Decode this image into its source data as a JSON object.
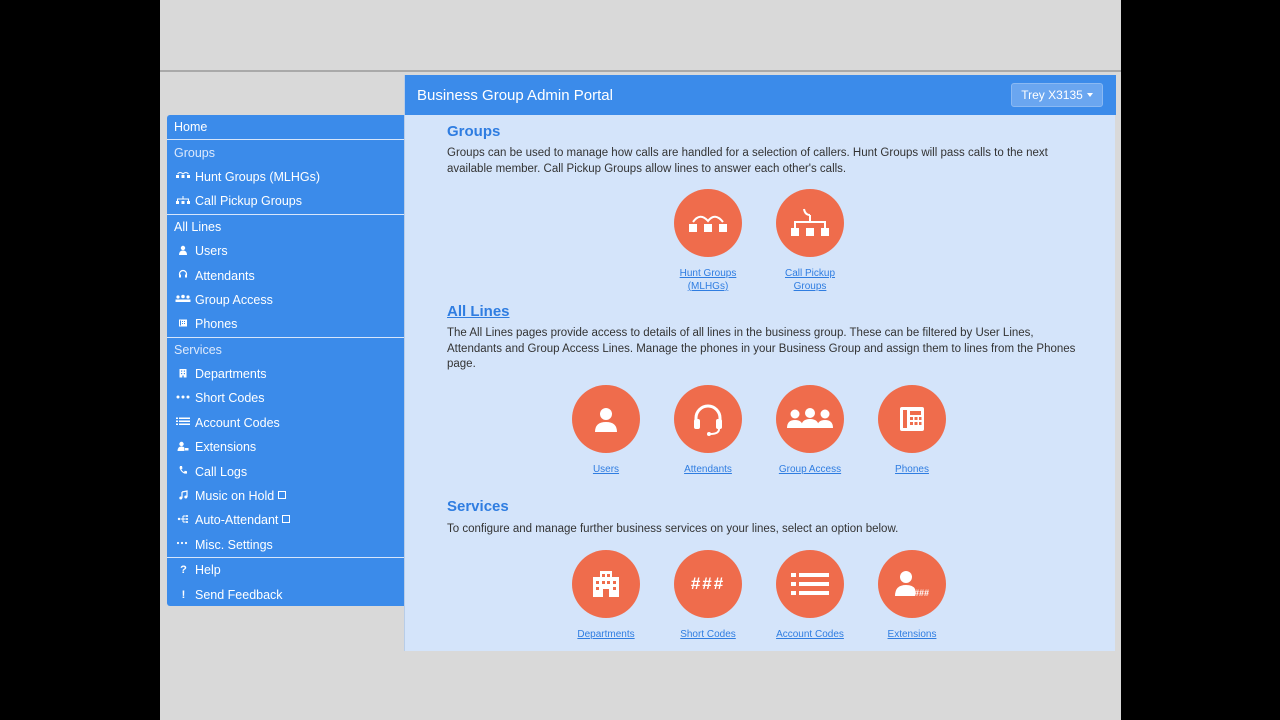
{
  "app": {
    "title": "Business Group Admin Portal",
    "user_button": "Trey X3135"
  },
  "sidebar": {
    "home": "Home",
    "groups_heading": "Groups",
    "groups_items": [
      {
        "label": "Hunt Groups (MLHGs)",
        "icon": "hunt-groups-icon"
      },
      {
        "label": "Call Pickup Groups",
        "icon": "call-pickup-icon"
      }
    ],
    "lines_heading": "All Lines",
    "lines_items": [
      {
        "label": "Users",
        "icon": "user-icon"
      },
      {
        "label": "Attendants",
        "icon": "headset-icon"
      },
      {
        "label": "Group Access",
        "icon": "group-access-icon"
      },
      {
        "label": "Phones",
        "icon": "phone-icon"
      }
    ],
    "services_heading": "Services",
    "services_items": [
      {
        "label": "Departments",
        "icon": "building-icon"
      },
      {
        "label": "Short Codes",
        "icon": "dots-icon"
      },
      {
        "label": "Account Codes",
        "icon": "list-icon"
      },
      {
        "label": "Extensions",
        "icon": "extension-icon"
      },
      {
        "label": "Call Logs",
        "icon": "call-log-icon"
      },
      {
        "label": "Music on Hold",
        "icon": "music-icon"
      },
      {
        "label": "Auto-Attendant",
        "icon": "auto-attendant-icon"
      },
      {
        "label": "Misc. Settings",
        "icon": "ellipsis-icon"
      }
    ],
    "help": "Help",
    "feedback": "Send Feedback"
  },
  "sections": {
    "groups": {
      "title": "Groups",
      "description": "Groups can be used to manage how calls are handled for a selection of callers. Hunt Groups will pass calls to the next available member. Call Pickup Groups allow lines to answer each other's calls.",
      "tiles": [
        {
          "label_line1": "Hunt Groups",
          "label_line2": "(MLHGs)"
        },
        {
          "label_line1": "Call Pickup",
          "label_line2": "Groups"
        }
      ]
    },
    "lines": {
      "title": "All Lines",
      "description": "The All Lines pages provide access to details of all lines in the business group. These can be filtered by User Lines, Attendants and Group Access Lines. Manage the phones in your Business Group and assign them to lines from the Phones page.",
      "tiles": [
        "Users",
        "Attendants",
        "Group Access",
        "Phones"
      ]
    },
    "services": {
      "title": "Services",
      "description": "To configure and manage further business services on your lines, select an option below.",
      "tiles": [
        "Departments",
        "Short Codes",
        "Account Codes",
        "Extensions"
      ],
      "short_codes_glyph": "###"
    }
  },
  "colors": {
    "accent_blue": "#3b8bea",
    "panel_bg": "#d4e4fa",
    "tile_orange": "#ef6c4c",
    "link_blue": "#2f7de1"
  }
}
